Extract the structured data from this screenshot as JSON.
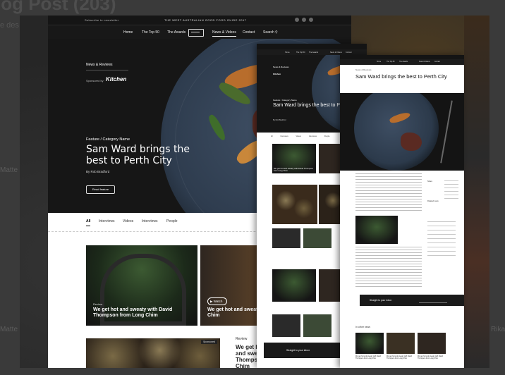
{
  "backdrop": {
    "title": "log Post (203)",
    "subtitle": "e des",
    "left_snips": [
      "Matte",
      "Matte"
    ],
    "right_snip": "Rika"
  },
  "main": {
    "topbar": {
      "subscribe": "Subscribe to newsletter",
      "guide": "THE WEST AUSTRALIAN GOOD FOOD GUIDE 2017"
    },
    "nav": {
      "home": "Home",
      "top50": "The Top 50",
      "awards": "The Awards",
      "news_videos": "News & Videos",
      "contact": "Contact",
      "search": "Search"
    },
    "hero": {
      "section": "News & Reviews",
      "sponsored_by": "Sponsored by",
      "sponsor": "Kitchen",
      "category": "Feature  /  Category Name",
      "headline": "Sam Ward brings the best to Perth City",
      "author": "By Rob Bradford",
      "read_button": "Read feature"
    },
    "tabs": [
      "All",
      "Interviews",
      "Videos",
      "Interviews",
      "People"
    ],
    "cards": [
      {
        "tag": "Review",
        "title": "We get hot and sweaty with David Thompson from Long Chim"
      },
      {
        "tag": "",
        "title": "We get hot and sweaty with David Thompson from Long Chim",
        "watch": "Watch"
      }
    ],
    "lower": {
      "badge": "Sponsored",
      "review_label": "Review",
      "review_title": "We get ho and swea Thomps Chim"
    }
  },
  "middle": {
    "hero": {
      "section": "News & Reviews",
      "sponsor": "Kitchen",
      "category": "Feature  /  Category Name",
      "headline": "Sam Ward brings the best to Perth City",
      "author": "By Rob Bradford"
    },
    "tabs": [
      "All",
      "Interviews",
      "Videos",
      "Interviews",
      "People"
    ],
    "card_title": "We get hot and sweaty with David Thompson from Long Chim",
    "footer": "Straight to your inbox"
  },
  "right": {
    "headline": "Sam Ward brings the best to Perth City",
    "kicker": "News & Reviews",
    "sidebar": [
      "Share",
      "Related news"
    ],
    "newsletter": "Straight to your inbox",
    "other": "In other news",
    "card_title": "We get hot and sweaty with David Thompson from Long Chim"
  }
}
